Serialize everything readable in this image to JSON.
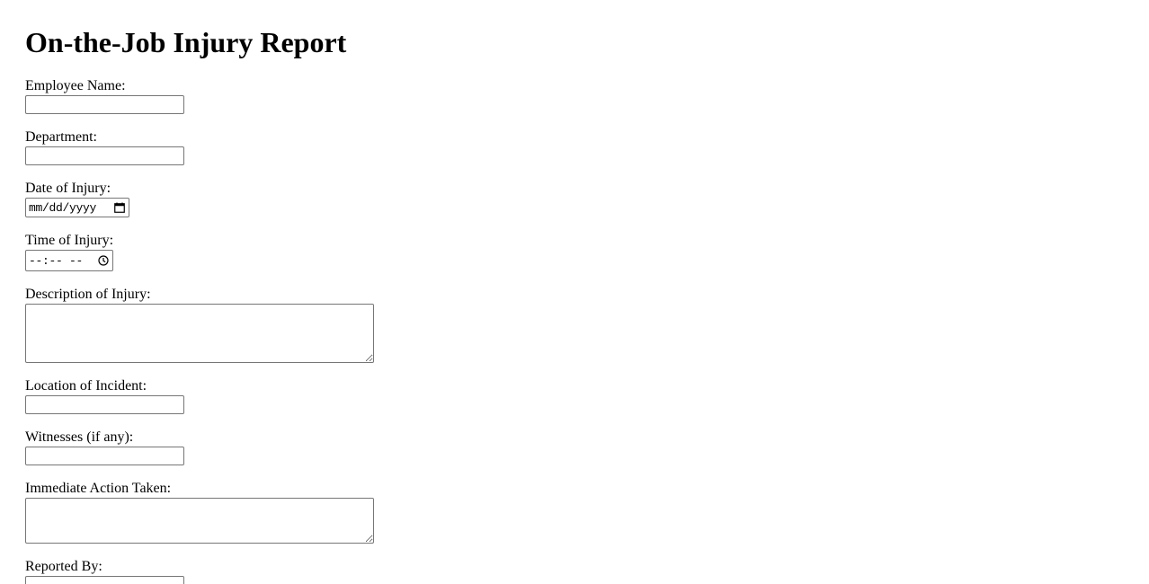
{
  "form": {
    "title": "On-the-Job Injury Report",
    "fields": {
      "employee_name": {
        "label": "Employee Name:",
        "value": ""
      },
      "department": {
        "label": "Department:",
        "value": ""
      },
      "date_of_injury": {
        "label": "Date of Injury:",
        "placeholder": "mm/dd/yyyy",
        "icon": "calendar-icon"
      },
      "time_of_injury": {
        "label": "Time of Injury:",
        "placeholder": "--:-- --",
        "icon": "clock-icon"
      },
      "description": {
        "label": "Description of Injury:",
        "value": ""
      },
      "location": {
        "label": "Location of Incident:",
        "value": ""
      },
      "witnesses": {
        "label": "Witnesses (if any):",
        "value": ""
      },
      "immediate_action": {
        "label": "Immediate Action Taken:",
        "value": ""
      },
      "reported_by": {
        "label": "Reported By:",
        "value": ""
      }
    }
  }
}
